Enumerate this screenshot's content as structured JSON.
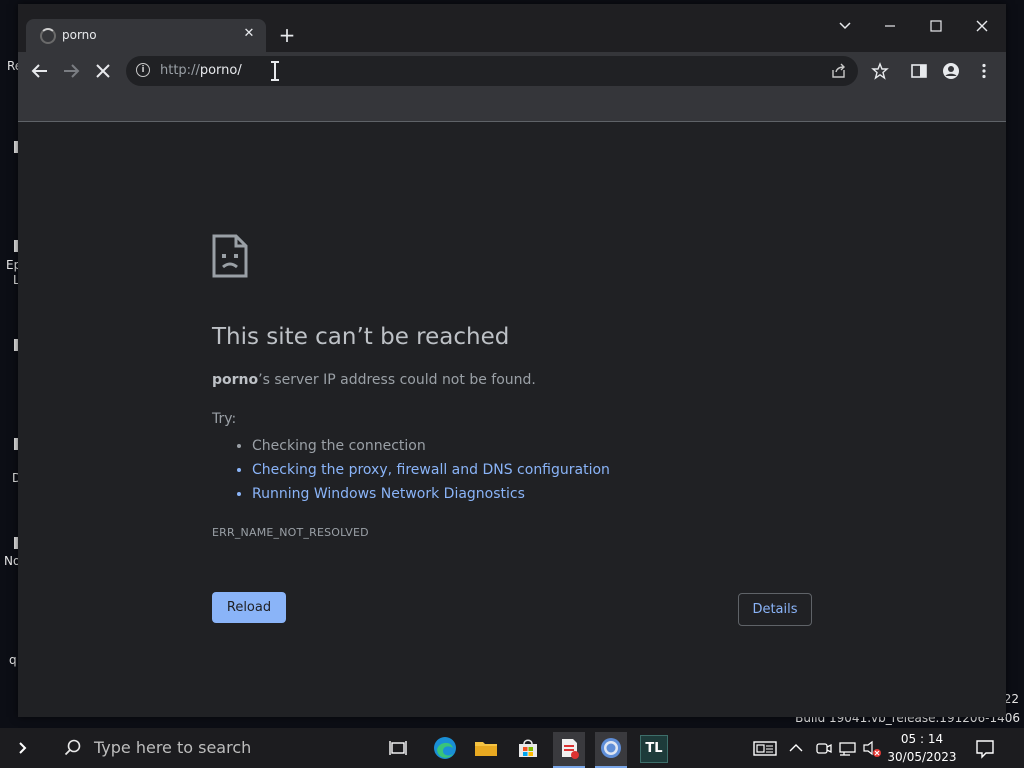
{
  "browser": {
    "tab_title": "porno",
    "tab_close": "✕",
    "new_tab": "+",
    "url_scheme": "http://",
    "url_host": "porno",
    "url_path": "/"
  },
  "error_page": {
    "heading": "This site can’t be reached",
    "host_bold": "porno",
    "message_rest": "’s server IP address could not be found.",
    "try_label": "Try:",
    "suggestions": [
      "Checking the connection",
      "Checking the proxy, firewall and DNS configuration",
      "Running Windows Network Diagnostics"
    ],
    "error_code": "ERR_NAME_NOT_RESOLVED",
    "reload_label": "Reload",
    "details_label": "Details"
  },
  "desktop": {
    "fragments": [
      "Re",
      "Ep",
      "L",
      "D",
      "No",
      "q"
    ],
    "build_number_suffix": "22",
    "build_text": "Build 19041.vb_release.191206-1406"
  },
  "taskbar": {
    "search_placeholder": "Type here to search",
    "time": "05 : 14",
    "date": "30/05/2023",
    "tl_label": "TL"
  },
  "colors": {
    "link": "#8ab4f8",
    "reload_bg": "#8ab4f8",
    "page_bg": "#202124"
  }
}
